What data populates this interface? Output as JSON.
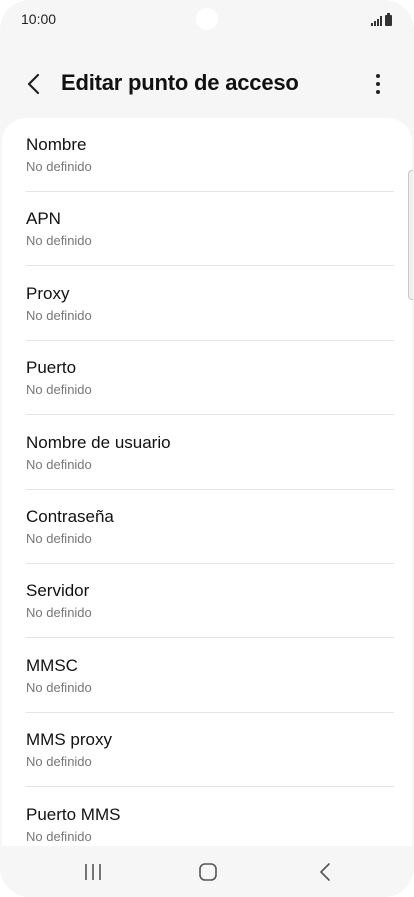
{
  "status_bar": {
    "time": "10:00"
  },
  "header": {
    "title": "Editar punto de acceso",
    "back_icon": "chevron-left-icon",
    "more_icon": "more-vertical-icon"
  },
  "items": [
    {
      "label": "Nombre",
      "value": "No definido"
    },
    {
      "label": "APN",
      "value": "No definido"
    },
    {
      "label": "Proxy",
      "value": "No definido"
    },
    {
      "label": "Puerto",
      "value": "No definido"
    },
    {
      "label": "Nombre de usuario",
      "value": "No definido"
    },
    {
      "label": "Contraseña",
      "value": "No definido"
    },
    {
      "label": "Servidor",
      "value": "No definido"
    },
    {
      "label": "MMSC",
      "value": "No definido"
    },
    {
      "label": "MMS proxy",
      "value": "No definido"
    },
    {
      "label": "Puerto MMS",
      "value": "No definido"
    }
  ],
  "nav_bar": {
    "recents_icon": "recents-icon",
    "home_icon": "home-icon",
    "back_icon": "back-icon"
  },
  "colors": {
    "background": "#f6f6f6",
    "card": "#ffffff",
    "primary_text": "#111111",
    "secondary_text": "#777777",
    "divider": "#e4e4e4"
  }
}
